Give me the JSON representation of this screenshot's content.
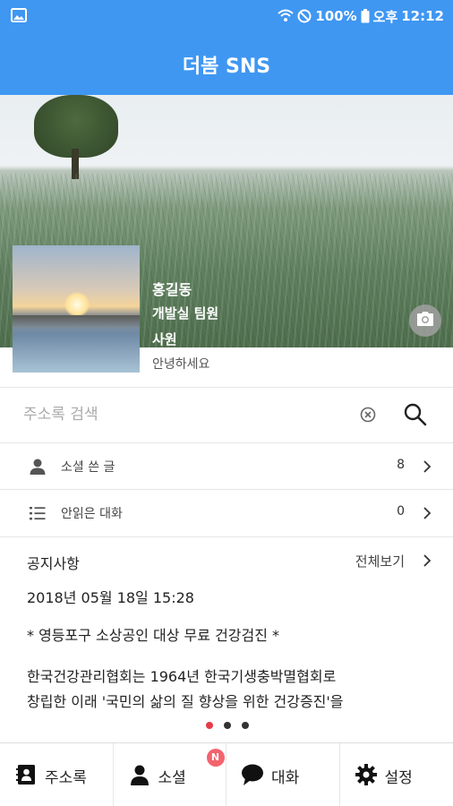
{
  "status_bar": {
    "battery": "100%",
    "ampm": "오후",
    "time": "12:12",
    "icons": [
      "image-icon",
      "wifi-icon",
      "do-not-disturb-icon",
      "battery-icon"
    ]
  },
  "app_bar": {
    "title": "더봄 SNS"
  },
  "profile": {
    "name": "홍길동",
    "department": "개발실 팀원",
    "rank": "사원",
    "status_message": "안녕하세요"
  },
  "search": {
    "placeholder": "주소록 검색",
    "value": ""
  },
  "rows": [
    {
      "icon": "person-icon",
      "label": "소셜 쓴 글",
      "count": "8"
    },
    {
      "icon": "list-icon",
      "label": "안읽은 대화",
      "count": "0"
    }
  ],
  "notice": {
    "title": "공지사항",
    "view_all": "전체보기",
    "date": "2018년 05월 18일 15:28",
    "subject": "* 영등포구 소상공인 대상 무료 건강검진 *",
    "body_line1": "한국건강관리협회는 1964년 한국기생충박멸협회로",
    "body_line2": "창립한 이래 '국민의 삶의 질 향상을 위한 건강증진'을",
    "page_count": 3,
    "active_page": 1
  },
  "tabs": [
    {
      "icon": "contacts-icon",
      "label": "주소록"
    },
    {
      "icon": "person-icon",
      "label": "소셜",
      "badge": "N"
    },
    {
      "icon": "chat-icon",
      "label": "대화"
    },
    {
      "icon": "gear-icon",
      "label": "설정"
    }
  ],
  "colors": {
    "primary": "#3f97f2",
    "badge": "#f3646e",
    "active_dot": "#e63b4a"
  }
}
